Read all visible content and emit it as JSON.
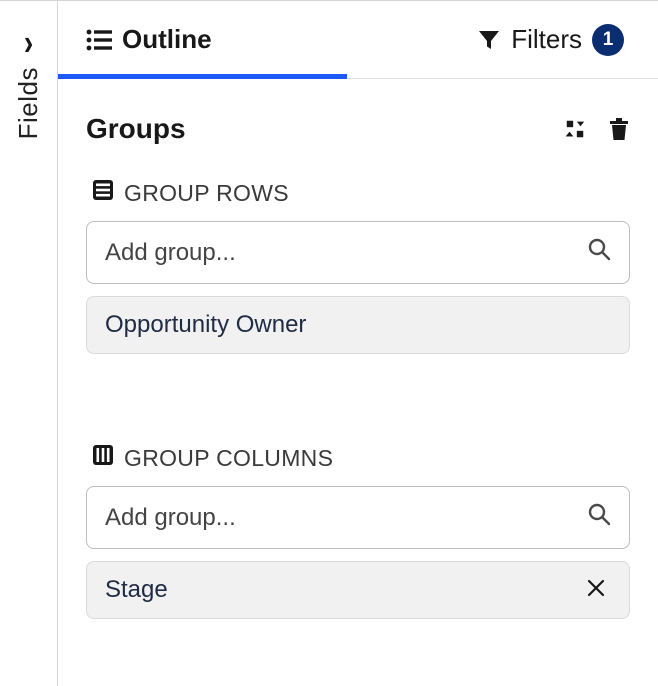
{
  "sidebar": {
    "label": "Fields"
  },
  "tabs": {
    "outline_label": "Outline",
    "filters_label": "Filters",
    "filters_count": "1"
  },
  "section": {
    "title": "Groups"
  },
  "group_rows": {
    "label": "GROUP ROWS",
    "placeholder": "Add group...",
    "items": [
      {
        "label": "Opportunity Owner",
        "removable": false
      }
    ]
  },
  "group_columns": {
    "label": "GROUP COLUMNS",
    "placeholder": "Add group...",
    "items": [
      {
        "label": "Stage",
        "removable": true
      }
    ]
  }
}
